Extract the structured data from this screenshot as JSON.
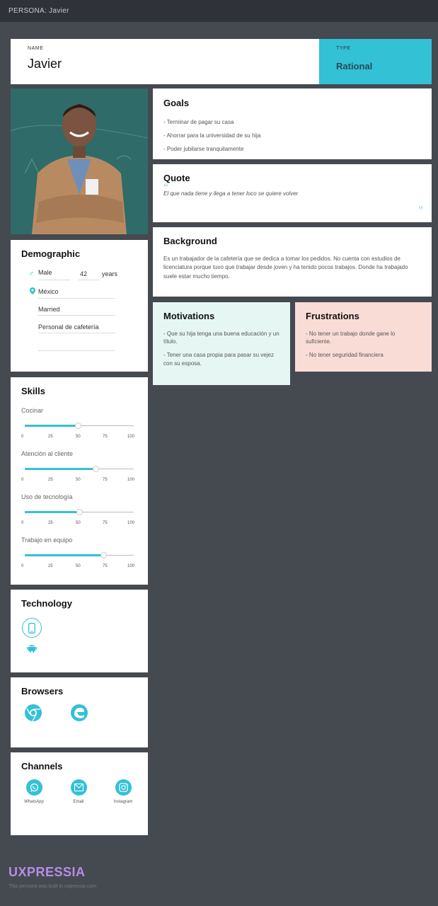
{
  "header": {
    "title": "PERSONA: Javier"
  },
  "persona": {
    "name_label": "NAME",
    "name": "Javier",
    "type_label": "TYPE",
    "type": "Rational"
  },
  "goals": {
    "title": "Goals",
    "items": [
      "- Terminar de pagar su casa",
      "- Ahorrar para la universidad de su hija",
      "- Poder jubilarse tranquilamente"
    ]
  },
  "quote": {
    "title": "Quote",
    "text": "El que nada tiene y llega a tener loco se quiere volver"
  },
  "background": {
    "title": "Background",
    "text": "Es un trabajador de la cafetería que se dedica a tomar los pedidos. No cuenta con estudios de licenciatura porque tuvo que trabajar desde joven y ha tenido pocos trabajos. Donde ha trabajado suele estar mucho tiempo."
  },
  "motivations": {
    "title": "Motivations",
    "items": [
      "- Que su hija tenga una buena educación y un título.",
      "- Tener una casa propia para pasar su vejez con su esposa."
    ]
  },
  "frustrations": {
    "title": "Frustrations",
    "items": [
      "- No tener un trabajo donde gane lo suficiente.",
      "- No tener seguridad financiera"
    ]
  },
  "demographic": {
    "title": "Demographic",
    "gender": "Male",
    "age": "42",
    "age_unit": "years",
    "location": "México",
    "status": "Married",
    "occupation": "Personal de cafetería"
  },
  "skills": {
    "title": "Skills",
    "ticks": [
      "0",
      "25",
      "50",
      "75",
      "100"
    ],
    "items": [
      {
        "name": "Cocinar",
        "value": 49
      },
      {
        "name": "Atención al cliente",
        "value": 65
      },
      {
        "name": "Uso de tecnología",
        "value": 50
      },
      {
        "name": "Trabajo en equipo",
        "value": 72
      }
    ]
  },
  "technology": {
    "title": "Technology",
    "icons": [
      "smartphone-icon",
      "android-icon"
    ]
  },
  "browsers": {
    "title": "Browsers",
    "icons": [
      "chrome-icon",
      "edge-icon"
    ]
  },
  "channels": {
    "title": "Channels",
    "items": [
      {
        "label": "WhatsApp",
        "icon": "whatsapp-icon"
      },
      {
        "label": "Email",
        "icon": "email-icon"
      },
      {
        "label": "Instagram",
        "icon": "instagram-icon"
      }
    ]
  },
  "footer": {
    "logo": "UXPRESSIA",
    "note": "This persona was built in uxpressia.com"
  },
  "colors": {
    "accent": "#33c1d6",
    "motivations_bg": "#e6f7f3",
    "frustrations_bg": "#fadcd7",
    "page_bg": "#454950"
  }
}
